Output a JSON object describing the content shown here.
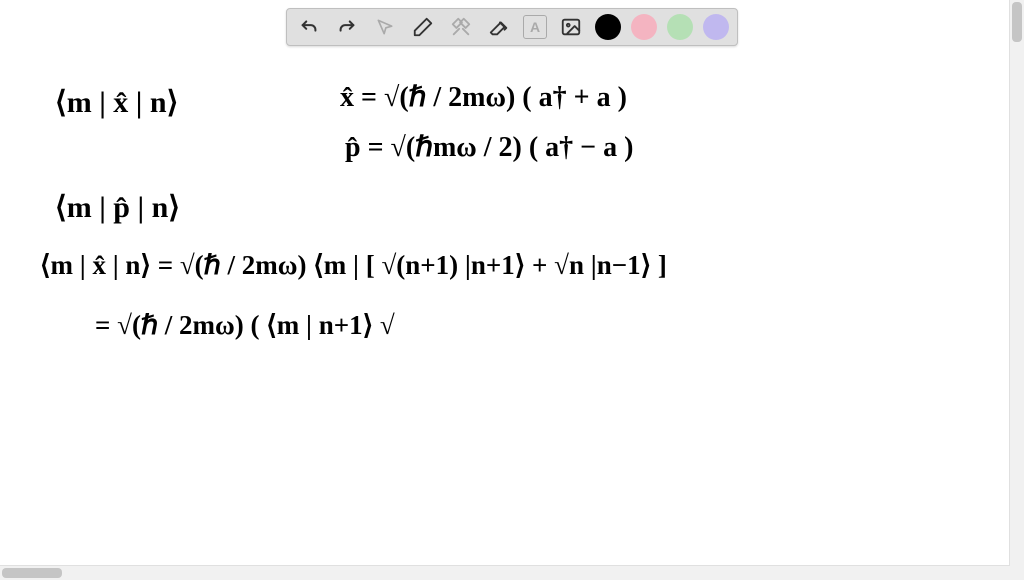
{
  "toolbar": {
    "undo": "undo",
    "redo": "redo",
    "pointer": "pointer",
    "pen": "pen",
    "tools": "tools",
    "eraser": "eraser",
    "textbox": "A",
    "image": "image",
    "colors": [
      "black",
      "pink",
      "green",
      "purple"
    ]
  },
  "math": {
    "line1": "⟨m | x̂ | n⟩",
    "line1b": "x̂ = √(ℏ / 2mω) ( a† + a )",
    "line2": "p̂ = √(ℏmω / 2) ( a† − a )",
    "line3": "⟨m | p̂ | n⟩",
    "line4": "⟨m | x̂ | n⟩ = √(ℏ / 2mω) ⟨m | [ √(n+1) |n+1⟩ + √n |n−1⟩ ]",
    "line5": "= √(ℏ / 2mω) ( ⟨m | n+1⟩ √"
  }
}
